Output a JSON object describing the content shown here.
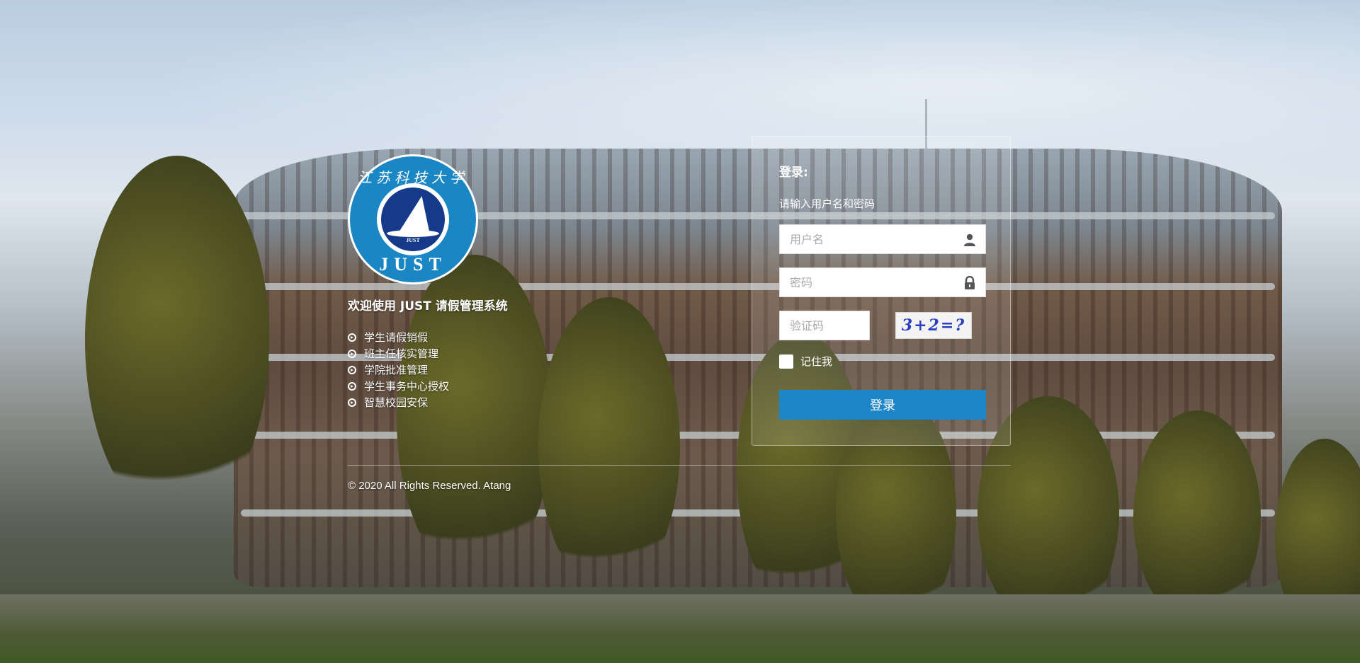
{
  "intro": {
    "logo": {
      "cn_text": "江苏科技大学",
      "en_text": "JUST",
      "small_text": "JUST"
    },
    "welcome": "欢迎使用 JUST 请假管理系统",
    "features": [
      {
        "label": "学生请假销假",
        "icon": "circle-arrow-right-icon"
      },
      {
        "label": "班主任核实管理",
        "icon": "circle-arrow-right-icon"
      },
      {
        "label": "学院批准管理",
        "icon": "circle-arrow-right-icon"
      },
      {
        "label": "学生事务中心授权",
        "icon": "circle-arrow-right-icon"
      },
      {
        "label": "智慧校园安保",
        "icon": "circle-arrow-right-icon"
      }
    ]
  },
  "login": {
    "title": "登录:",
    "hint": "请输入用户名和密码",
    "username": {
      "value": "",
      "placeholder": "用户名",
      "icon": "user-icon"
    },
    "password": {
      "value": "",
      "placeholder": "密码",
      "icon": "lock-icon"
    },
    "captcha": {
      "value": "",
      "placeholder": "验证码",
      "image_text": "3+2=?"
    },
    "remember_label": "记住我",
    "remember_checked": false,
    "submit_label": "登录",
    "accent_color": "#1e86c8"
  },
  "footer": {
    "copyright": "© 2020 All Rights Reserved. Atang"
  }
}
